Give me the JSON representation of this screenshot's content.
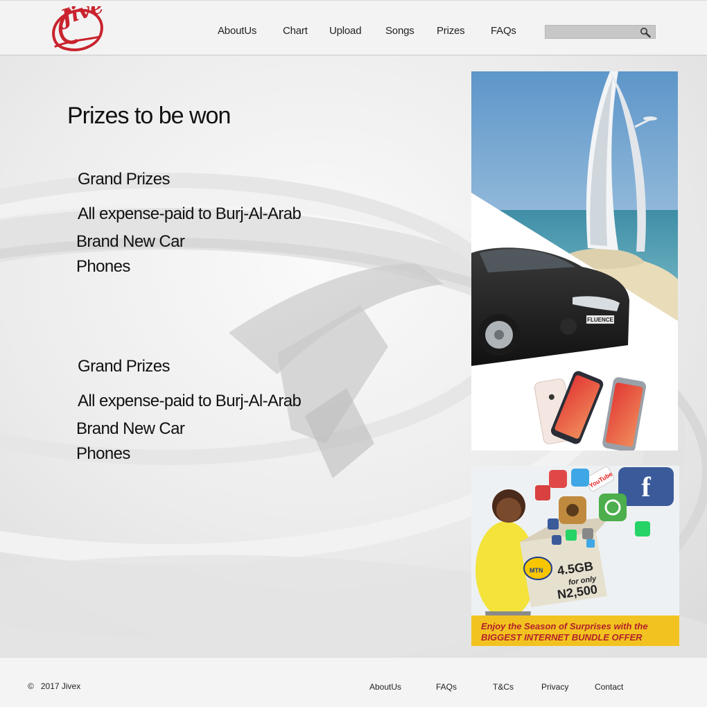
{
  "header": {
    "logo_text": "Jive",
    "nav": [
      "AboutUs",
      "Chart",
      "Upload",
      "Songs",
      "Prizes",
      "FAQs"
    ],
    "search": {
      "value": "",
      "placeholder": ""
    }
  },
  "main": {
    "title": "Prizes to be won",
    "prize_groups": [
      {
        "heading": "Grand Prizes",
        "items": [
          "All expense-paid to Burj-Al-Arab",
          "Brand New Car",
          "Phones"
        ]
      },
      {
        "heading": "Grand Prizes",
        "items": [
          "All expense-paid to Burj-Al-Arab",
          "Brand New Car",
          "Phones"
        ]
      }
    ]
  },
  "banners": {
    "prizes_banner": {
      "car_badge": "FLUENCE"
    },
    "mtn_ad": {
      "brand": "MTN",
      "data_amount": "4.5GB",
      "for_only": "for only",
      "price": "N2,500",
      "tagline_1": "Enjoy the Season of Surprises with the",
      "tagline_2": "BIGGEST INTERNET BUNDLE OFFER",
      "social_label": "YouTube"
    }
  },
  "footer": {
    "copyright_symbol": "©",
    "copyright_text": "2017 Jivex",
    "links": [
      "AboutUs",
      "FAQs",
      "T&Cs",
      "Privacy",
      "Contact"
    ]
  }
}
